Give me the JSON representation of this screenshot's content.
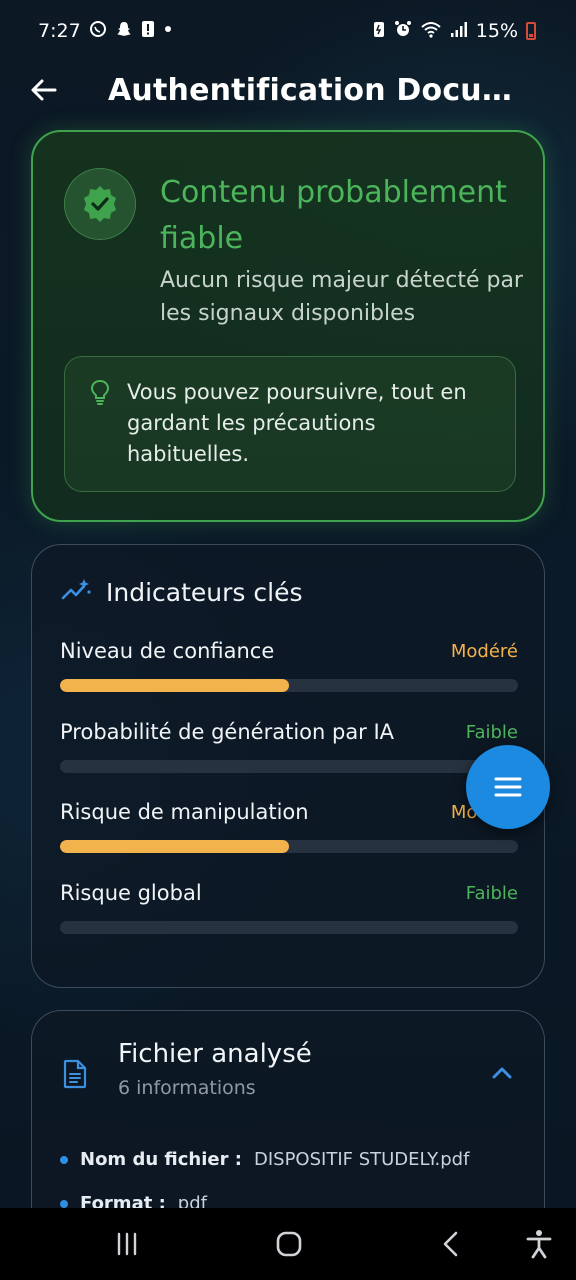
{
  "status_bar": {
    "time": "7:27",
    "battery": "15%"
  },
  "app_bar": {
    "title": "Authentification Docum..."
  },
  "verdict": {
    "title": "Contenu probablement fiable",
    "subtitle": "Aucun risque majeur détecté par les signaux disponibles",
    "advice": "Vous pouvez poursuivre, tout en gardant les précautions habituelles.",
    "accent_color": "#4cb45a",
    "icon": "verified-badge-icon"
  },
  "indicators": {
    "title": "Indicateurs clés",
    "icon": "sparkle-trend-icon",
    "items": [
      {
        "label": "Niveau de confiance",
        "level": "Modéré",
        "level_color": "#f3b34c",
        "progress": 0.5
      },
      {
        "label": "Probabilité de génération par IA",
        "level": "Faible",
        "level_color": "#4cb45a",
        "progress": 0
      },
      {
        "label": "Risque de manipulation",
        "level": "Modéré",
        "level_color": "#f3b34c",
        "progress": 0.5
      },
      {
        "label": "Risque global",
        "level": "Faible",
        "level_color": "#4cb45a",
        "progress": 0
      }
    ]
  },
  "file": {
    "title": "Fichier analysé",
    "subtitle": "6 informations",
    "icon": "document-icon",
    "items": [
      {
        "key": "Nom du fichier :",
        "value": "DISPOSITIF STUDELY.pdf"
      },
      {
        "key": "Format :",
        "value": "pdf"
      }
    ]
  },
  "fab": {
    "icon": "menu-icon",
    "color": "#1c8ae0"
  },
  "nav_bar": {
    "icons": [
      "recent-apps-icon",
      "home-icon",
      "back-icon",
      "accessibility-icon"
    ]
  }
}
